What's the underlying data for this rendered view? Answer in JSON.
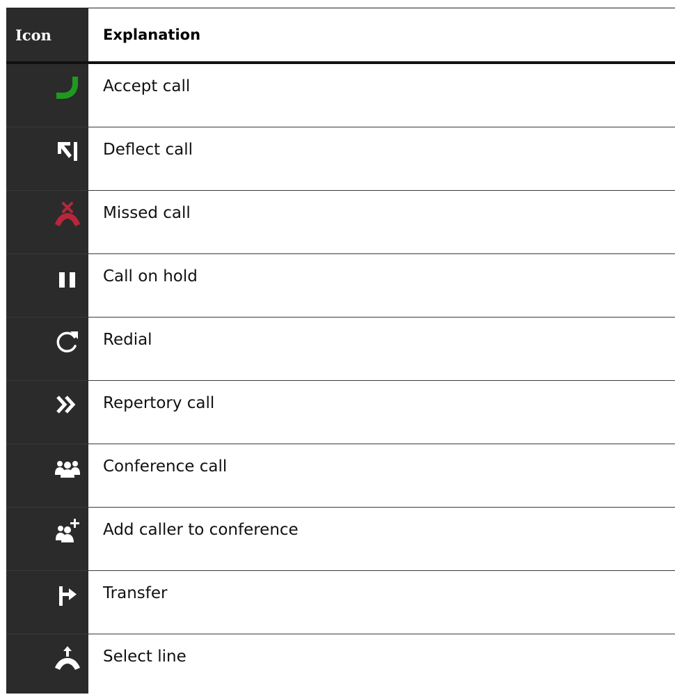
{
  "header": {
    "icon_col": "Icon",
    "explanation_col": "Explanation"
  },
  "rows": [
    {
      "icon": "accept-call-icon",
      "label": "Accept call"
    },
    {
      "icon": "deflect-call-icon",
      "label": "Deflect call"
    },
    {
      "icon": "missed-call-icon",
      "label": "Missed call"
    },
    {
      "icon": "hold-icon",
      "label": "Call on hold"
    },
    {
      "icon": "redial-icon",
      "label": "Redial"
    },
    {
      "icon": "repertory-icon",
      "label": "Repertory call"
    },
    {
      "icon": "conference-icon",
      "label": "Conference call"
    },
    {
      "icon": "add-conference-icon",
      "label": "Add caller to conference"
    },
    {
      "icon": "transfer-icon",
      "label": "Transfer"
    },
    {
      "icon": "select-line-icon",
      "label": "Select line"
    }
  ],
  "colors": {
    "icon_column_bg": "#2b2b2b",
    "accept_green": "#1f9a1f",
    "missed_red": "#b8263a",
    "icon_white": "#ffffff"
  }
}
